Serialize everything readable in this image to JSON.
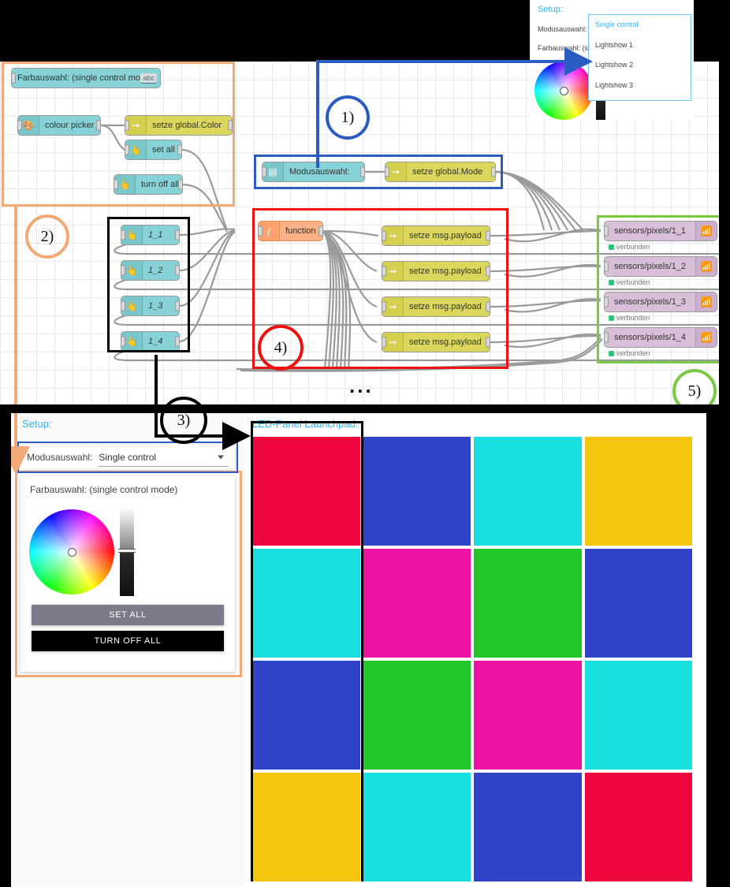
{
  "setup_popup": {
    "title": "Setup:",
    "row1_label": "Modusauswahl:",
    "row2_label": "Farbauswahl: (s",
    "dropdown_options": [
      "Single control",
      "Lightshow 1",
      "Lightshow 2",
      "Lightshow 3"
    ],
    "selected_option": "Single control"
  },
  "flow": {
    "color_group": {
      "ui_text_node": "Farbauswahl: (single control mode)",
      "ui_text_badge": "abc",
      "colour_picker": "colour picker",
      "set_global_color": "setze global.Color",
      "set_all": "set all",
      "turn_off_all": "turn off all"
    },
    "mode_group": {
      "dropdown_node": "Modusauswahl:",
      "set_global_mode": "setze global.Mode"
    },
    "buttons": [
      "1_1",
      "1_2",
      "1_3",
      "1_4"
    ],
    "function_node": "function",
    "change_nodes": [
      "setze msg.payload",
      "setze msg.payload",
      "setze msg.payload",
      "setze msg.payload"
    ],
    "mqtt_nodes": [
      {
        "topic": "sensors/pixels/1_1",
        "status": "verbunden"
      },
      {
        "topic": "sensors/pixels/1_2",
        "status": "verbunden"
      },
      {
        "topic": "sensors/pixels/1_3",
        "status": "verbunden"
      },
      {
        "topic": "sensors/pixels/1_4",
        "status": "verbunden"
      }
    ],
    "ellipsis": "..."
  },
  "annotations": [
    {
      "id": "1",
      "label": "1)",
      "color": "#2a5cc2"
    },
    {
      "id": "2",
      "label": "2)",
      "color": "#f3a878"
    },
    {
      "id": "3",
      "label": "3)",
      "color": "#000000"
    },
    {
      "id": "4",
      "label": "4)",
      "color": "#ee1111"
    },
    {
      "id": "5",
      "label": "5)",
      "color": "#7ac943"
    }
  ],
  "dashboard": {
    "setup_title": "Setup:",
    "mode_label": "Modusauswahl:",
    "mode_value": "Single control",
    "color_card_title": "Farbauswahl: (single control mode)",
    "set_all_button": "SET ALL",
    "turn_off_button": "TURN OFF ALL",
    "led_panel_title": "LED-Panel Launchpad:"
  },
  "chart_data": {
    "type": "heatmap",
    "title": "LED-Panel Launchpad:",
    "rows": 4,
    "cols": 4,
    "cells": [
      [
        "#f0063f",
        "#2f44c8",
        "#19dfdf",
        "#f5c60d"
      ],
      [
        "#19dfdf",
        "#ed12a4",
        "#20c62a",
        "#2f44c8"
      ],
      [
        "#2f44c8",
        "#20c62a",
        "#ed12a4",
        "#19dfdf"
      ],
      [
        "#f5c60d",
        "#19dfdf",
        "#2f44c8",
        "#f0063f"
      ]
    ]
  },
  "colors": {
    "accent_blue": "#29b6f6",
    "ann_blue": "#2a5cc2",
    "ann_orange": "#f3a878",
    "ann_red": "#ee1111",
    "ann_green": "#7ac943",
    "ann_black": "#000000"
  }
}
